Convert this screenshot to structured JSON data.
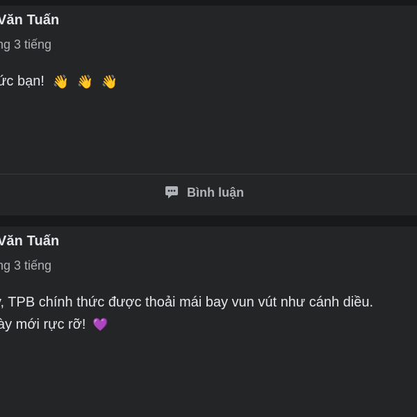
{
  "posts": [
    {
      "author": "n Văn Tuấn",
      "meta": "ng 3 tiếng",
      "lines": [
        "ức bạn!"
      ],
      "emojis": [
        "👋",
        "👋",
        "👋"
      ],
      "action": {
        "label": "Bình luận",
        "icon": "comment-icon"
      }
    },
    {
      "author": "n Văn Tuấn",
      "meta": "ng 3 tiếng",
      "lines": [
        "y, TPB chính thức được thoải mái bay vun vút như cánh diều.",
        "ày mới rực rỡ!"
      ],
      "emoji": "💜"
    }
  ],
  "colors": {
    "background": "#18191a",
    "card": "#242526",
    "primary_text": "#e4e6eb",
    "secondary_text": "#b0b3b8",
    "divider": "#3a3b3c"
  }
}
